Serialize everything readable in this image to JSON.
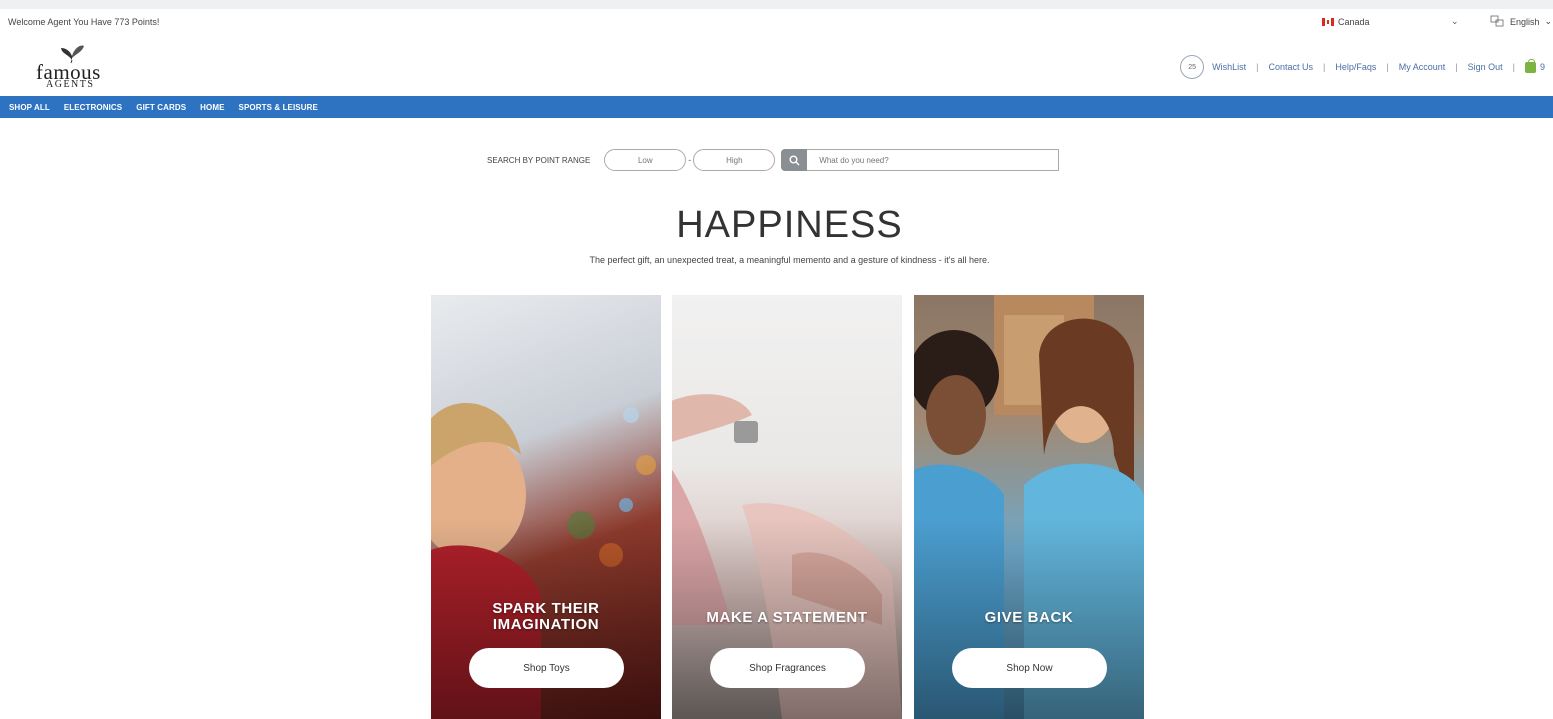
{
  "header": {
    "welcome": "Welcome Agent You Have 773 Points!",
    "country": "Canada",
    "language": "English",
    "logo_word": "famous",
    "logo_sub": "AGENTS",
    "points_count": "25",
    "links": {
      "wishlist": "WishList",
      "contact": "Contact Us",
      "help": "Help/Faqs",
      "account": "My Account",
      "signout": "Sign Out",
      "cart_count": "9"
    }
  },
  "nav": {
    "items": [
      "SHOP ALL",
      "ELECTRONICS",
      "GIFT CARDS",
      "HOME",
      "SPORTS & LEISURE"
    ]
  },
  "search": {
    "label": "SEARCH BY POINT RANGE",
    "low_placeholder": "Low",
    "high_placeholder": "High",
    "dash": "-",
    "query_placeholder": "What do you need?"
  },
  "hero": {
    "title": "HAPPINESS",
    "subtitle": "The perfect gift, an unexpected treat, a meaningful memento and a gesture of kindness - it's all here."
  },
  "cards": [
    {
      "heading_line1": "SPARK THEIR",
      "heading_line2": "IMAGINATION",
      "button": "Shop Toys"
    },
    {
      "heading_line1": "MAKE A STATEMENT",
      "heading_line2": "",
      "button": "Shop Fragrances"
    },
    {
      "heading_line1": "GIVE BACK",
      "heading_line2": "",
      "button": "Shop Now"
    }
  ],
  "colors": {
    "nav_bg": "#2e72c2",
    "link": "#4a6fa5",
    "cart": "#7cb342"
  }
}
